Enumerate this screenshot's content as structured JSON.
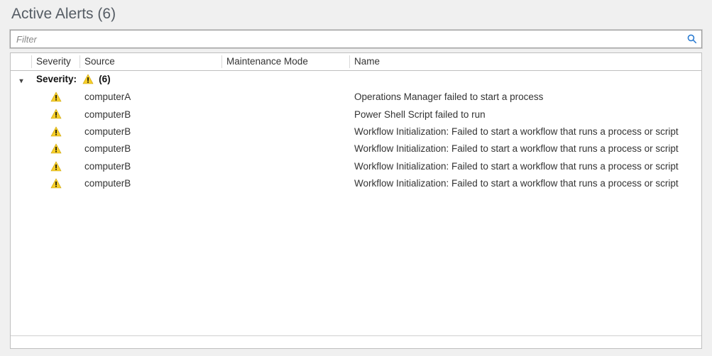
{
  "title_prefix": "Active Alerts",
  "count": 6,
  "filter": {
    "placeholder": "Filter",
    "value": ""
  },
  "columns": {
    "severity": "Severity",
    "source": "Source",
    "maintenance_mode": "Maintenance Mode",
    "name": "Name"
  },
  "group": {
    "label": "Severity:",
    "count_text": "(6)"
  },
  "rows": [
    {
      "source": "computerA",
      "maintenance_mode": "",
      "name": "Operations Manager failed to start a process"
    },
    {
      "source": "computerB",
      "maintenance_mode": "",
      "name": "Power Shell Script failed to run"
    },
    {
      "source": "computerB",
      "maintenance_mode": "",
      "name": "Workflow Initialization: Failed to start a workflow that runs a process or script"
    },
    {
      "source": "computerB",
      "maintenance_mode": "",
      "name": "Workflow Initialization: Failed to start a workflow that runs a process or script"
    },
    {
      "source": "computerB",
      "maintenance_mode": "",
      "name": "Workflow Initialization: Failed to start a workflow that runs a process or script"
    },
    {
      "source": "computerB",
      "maintenance_mode": "",
      "name": "Workflow Initialization: Failed to start a workflow that runs a process or script"
    }
  ]
}
